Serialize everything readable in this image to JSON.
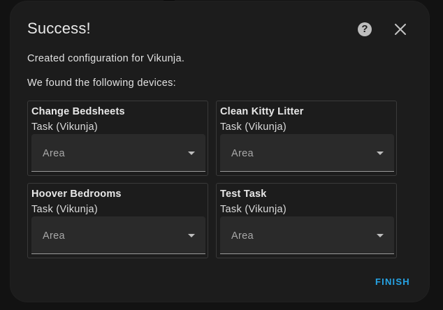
{
  "dialog": {
    "title": "Success!",
    "help_icon": "help-circle-icon",
    "close_icon": "close-icon",
    "message": "Created configuration for Vikunja.",
    "devices_intro": "We found the following devices:",
    "finish_label": "FINISH",
    "accent_color": "#26a4e6"
  },
  "devices": [
    {
      "name": "Change Bedsheets",
      "type": "Task (Vikunja)",
      "area_label": "Area"
    },
    {
      "name": "Clean Kitty Litter",
      "type": "Task (Vikunja)",
      "area_label": "Area"
    },
    {
      "name": "Hoover Bedrooms",
      "type": "Task (Vikunja)",
      "area_label": "Area"
    },
    {
      "name": "Test Task",
      "type": "Task (Vikunja)",
      "area_label": "Area"
    }
  ]
}
